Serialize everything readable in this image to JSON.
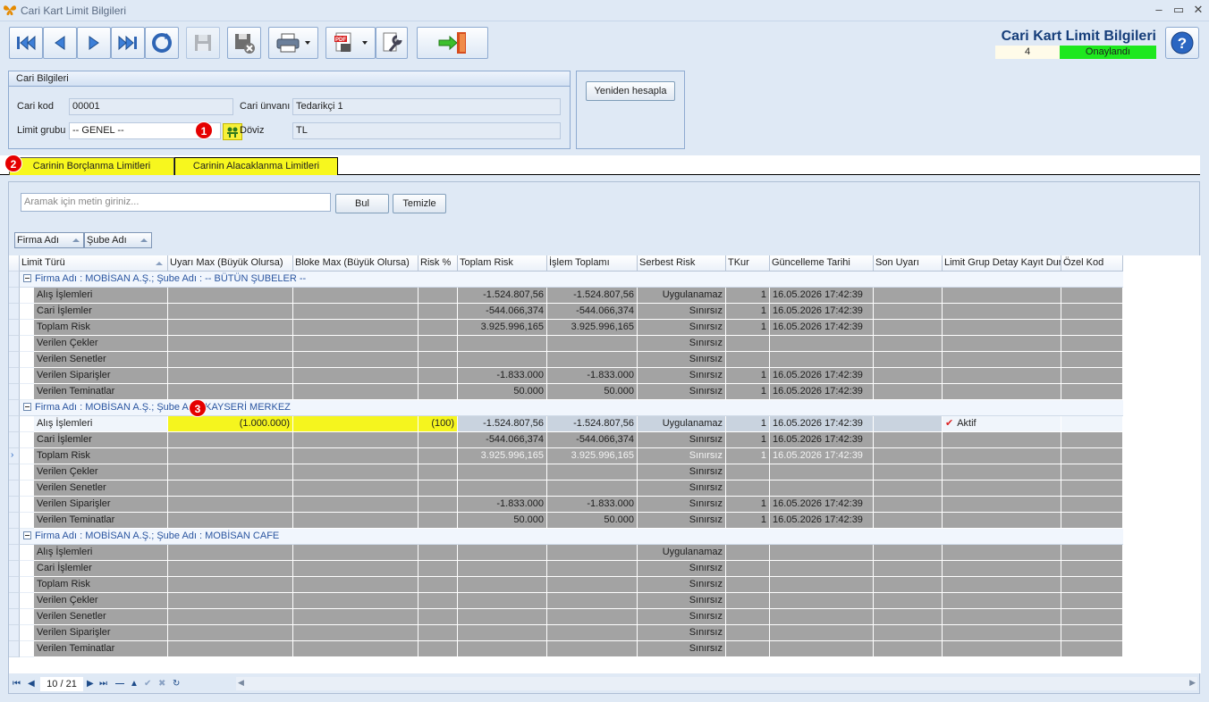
{
  "window": {
    "title": "Cari Kart Limit Bilgileri"
  },
  "header": {
    "title": "Cari Kart Limit Bilgileri",
    "count": "4",
    "status": "Onaylandı",
    "status_color": "#1ee81e"
  },
  "cari": {
    "section_title": "Cari Bilgileri",
    "kod_label": "Cari kod",
    "kod_value": "00001",
    "unvan_label": "Cari ünvanı",
    "unvan_value": "Tedarikçi 1",
    "limit_grubu_label": "Limit grubu",
    "limit_grubu_value": "-- GENEL --",
    "doviz_label": "Döviz",
    "doviz_value": "TL"
  },
  "recalc_label": "Yeniden hesapla",
  "badges": [
    "1",
    "2",
    "3"
  ],
  "tabs": [
    "Carinin Borçlanma Limitleri",
    "Carinin Alacaklanma Limitleri"
  ],
  "search": {
    "placeholder": "Aramak için metin giriniz...",
    "find": "Bul",
    "clear": "Temizle"
  },
  "group_chips": [
    "Firma Adı",
    "Şube Adı"
  ],
  "columns": [
    "Limit Türü",
    "Uyarı Max (Büyük Olursa)",
    "Bloke Max (Büyük Olursa)",
    "Risk %",
    "Toplam Risk",
    "İşlem Toplamı",
    "Serbest Risk",
    "TKur",
    "Güncelleme Tarihi",
    "Son Uyarı",
    "Limit Grup Detay Kayıt Durumu",
    "Özel Kod"
  ],
  "groups": [
    {
      "title": "Firma Adı : MOBİSAN A.Ş.;  Şube Adı : -- BÜTÜN ŞUBELER --",
      "rows": [
        [
          "Alış İşlemleri",
          "",
          "",
          "",
          "-1.524.807,56",
          "-1.524.807,56",
          "Uygulanamaz",
          "1",
          "16.05.2026 17:42:39",
          "",
          "",
          ""
        ],
        [
          "Cari İşlemler",
          "",
          "",
          "",
          "-544.066,374",
          "-544.066,374",
          "Sınırsız",
          "1",
          "16.05.2026 17:42:39",
          "",
          "",
          ""
        ],
        [
          "Toplam Risk",
          "",
          "",
          "",
          "3.925.996,165",
          "3.925.996,165",
          "Sınırsız",
          "1",
          "16.05.2026 17:42:39",
          "",
          "",
          ""
        ],
        [
          "Verilen Çekler",
          "",
          "",
          "",
          "",
          "",
          "Sınırsız",
          "",
          "",
          "",
          "",
          ""
        ],
        [
          "Verilen Senetler",
          "",
          "",
          "",
          "",
          "",
          "Sınırsız",
          "",
          "",
          "",
          "",
          ""
        ],
        [
          "Verilen Siparişler",
          "",
          "",
          "",
          "-1.833.000",
          "-1.833.000",
          "Sınırsız",
          "1",
          "16.05.2026 17:42:39",
          "",
          "",
          ""
        ],
        [
          "Verilen Teminatlar",
          "",
          "",
          "",
          "50.000",
          "50.000",
          "Sınırsız",
          "1",
          "16.05.2026 17:42:39",
          "",
          "",
          ""
        ]
      ]
    },
    {
      "title": "Firma Adı : MOBİSAN A.Ş.;  Şube Adı : KAYSERİ MERKEZ",
      "rows": [
        [
          "Alış İşlemleri",
          "(1.000.000)",
          "",
          "(100)",
          "-1.524.807,56",
          "-1.524.807,56",
          "Uygulanamaz",
          "1",
          "16.05.2026 17:42:39",
          "",
          "Aktif",
          ""
        ],
        [
          "Cari İşlemler",
          "",
          "",
          "",
          "-544.066,374",
          "-544.066,374",
          "Sınırsız",
          "1",
          "16.05.2026 17:42:39",
          "",
          "",
          ""
        ],
        [
          "Toplam Risk",
          "",
          "",
          "",
          "3.925.996,165",
          "3.925.996,165",
          "Sınırsız",
          "1",
          "16.05.2026 17:42:39",
          "",
          "",
          ""
        ],
        [
          "Verilen Çekler",
          "",
          "",
          "",
          "",
          "",
          "Sınırsız",
          "",
          "",
          "",
          "",
          ""
        ],
        [
          "Verilen Senetler",
          "",
          "",
          "",
          "",
          "",
          "Sınırsız",
          "",
          "",
          "",
          "",
          ""
        ],
        [
          "Verilen Siparişler",
          "",
          "",
          "",
          "-1.833.000",
          "-1.833.000",
          "Sınırsız",
          "1",
          "16.05.2026 17:42:39",
          "",
          "",
          ""
        ],
        [
          "Verilen Teminatlar",
          "",
          "",
          "",
          "50.000",
          "50.000",
          "Sınırsız",
          "1",
          "16.05.2026 17:42:39",
          "",
          "",
          ""
        ]
      ]
    },
    {
      "title": "Firma Adı : MOBİSAN A.Ş.;  Şube Adı : MOBİSAN CAFE",
      "rows": [
        [
          "Alış İşlemleri",
          "",
          "",
          "",
          "",
          "",
          "Uygulanamaz",
          "",
          "",
          "",
          "",
          ""
        ],
        [
          "Cari İşlemler",
          "",
          "",
          "",
          "",
          "",
          "Sınırsız",
          "",
          "",
          "",
          "",
          ""
        ],
        [
          "Toplam Risk",
          "",
          "",
          "",
          "",
          "",
          "Sınırsız",
          "",
          "",
          "",
          "",
          ""
        ],
        [
          "Verilen Çekler",
          "",
          "",
          "",
          "",
          "",
          "Sınırsız",
          "",
          "",
          "",
          "",
          ""
        ],
        [
          "Verilen Senetler",
          "",
          "",
          "",
          "",
          "",
          "Sınırsız",
          "",
          "",
          "",
          "",
          ""
        ],
        [
          "Verilen Siparişler",
          "",
          "",
          "",
          "",
          "",
          "Sınırsız",
          "",
          "",
          "",
          "",
          ""
        ],
        [
          "Verilen Teminatlar",
          "",
          "",
          "",
          "",
          "",
          "Sınırsız",
          "",
          "",
          "",
          "",
          ""
        ]
      ]
    }
  ],
  "navigator": {
    "page": "10 / 21"
  }
}
